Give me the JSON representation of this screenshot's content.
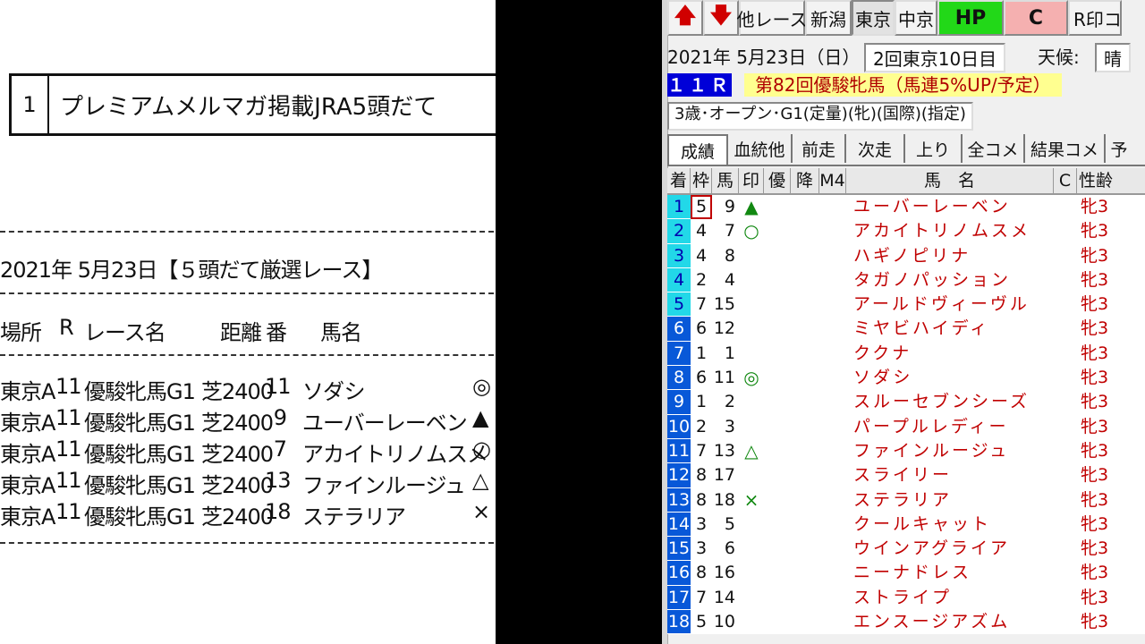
{
  "left": {
    "box_number": "1",
    "box_title": "プレミアムメルマガ掲載JRA5頭だて",
    "date_line": "2021年 5月23日【５頭だて厳選レース】",
    "headers": {
      "venue": "場所",
      "r": "R",
      "race": "レース名",
      "dist": "距離",
      "num": "番",
      "horse": "馬名"
    },
    "rows": [
      {
        "venue": "東京A",
        "r": "11",
        "race": "優駿牝馬G1",
        "dist": "芝2400",
        "num": "11",
        "horse": "ソダシ",
        "mark": "◎"
      },
      {
        "venue": "東京A",
        "r": "11",
        "race": "優駿牝馬G1",
        "dist": "芝2400",
        "num": "9",
        "horse": "ユーバーレーベン",
        "mark": "▲"
      },
      {
        "venue": "東京A",
        "r": "11",
        "race": "優駿牝馬G1",
        "dist": "芝2400",
        "num": "7",
        "horse": "アカイトリノムスメ",
        "mark": "○"
      },
      {
        "venue": "東京A",
        "r": "11",
        "race": "優駿牝馬G1",
        "dist": "芝2400",
        "num": "13",
        "horse": "ファインルージュ",
        "mark": "△"
      },
      {
        "venue": "東京A",
        "r": "11",
        "race": "優駿牝馬G1",
        "dist": "芝2400",
        "num": "18",
        "horse": "ステラリア",
        "mark": "×"
      }
    ]
  },
  "right": {
    "toolbar": {
      "up_icon": "up-arrow-icon",
      "down_icon": "down-arrow-icon",
      "up_glyph": "🡅",
      "down_glyph": "🡇",
      "other_race": "他レース",
      "niigata": "新潟",
      "tokyo": "東京",
      "chukyo": "中京",
      "hp": "HP",
      "c": "C",
      "r_print": "R印コ"
    },
    "info": {
      "date": "2021年 5月23日（日）",
      "meeting": "2回東京10日目",
      "weather_label": "天候:",
      "weather": "晴"
    },
    "race_no": "１１Ｒ",
    "race_name": "第82回優駿牝馬（馬連5%UP/予定）",
    "conditions": "3歳･オープン･G1(定量)(牝)(国際)(指定)",
    "tabs": [
      "成績",
      "血統他",
      "前走",
      "次走",
      "上り",
      "全コメ",
      "結果コメ",
      "予"
    ],
    "grid_headers": {
      "pos": "着",
      "waku": "枠",
      "uma": "馬",
      "mark": "印",
      "yu": "優",
      "ko": "降",
      "m4": "M4",
      "name": "馬　名",
      "c": "C",
      "sex": "性齢"
    },
    "rows": [
      {
        "pos": "1",
        "waku": "5",
        "uma": "9",
        "mark": "▲",
        "name": "ユーバーレーベン",
        "sex": "牝3"
      },
      {
        "pos": "2",
        "waku": "4",
        "uma": "7",
        "mark": "○",
        "name": "アカイトリノムスメ",
        "sex": "牝3"
      },
      {
        "pos": "3",
        "waku": "4",
        "uma": "8",
        "mark": "",
        "name": "ハギノピリナ",
        "sex": "牝3"
      },
      {
        "pos": "4",
        "waku": "2",
        "uma": "4",
        "mark": "",
        "name": "タガノパッション",
        "sex": "牝3"
      },
      {
        "pos": "5",
        "waku": "7",
        "uma": "15",
        "mark": "",
        "name": "アールドヴィーヴル",
        "sex": "牝3"
      },
      {
        "pos": "6",
        "waku": "6",
        "uma": "12",
        "mark": "",
        "name": "ミヤビハイディ",
        "sex": "牝3"
      },
      {
        "pos": "7",
        "waku": "1",
        "uma": "1",
        "mark": "",
        "name": "ククナ",
        "sex": "牝3"
      },
      {
        "pos": "8",
        "waku": "6",
        "uma": "11",
        "mark": "◎",
        "name": "ソダシ",
        "sex": "牝3"
      },
      {
        "pos": "9",
        "waku": "1",
        "uma": "2",
        "mark": "",
        "name": "スルーセブンシーズ",
        "sex": "牝3"
      },
      {
        "pos": "10",
        "waku": "2",
        "uma": "3",
        "mark": "",
        "name": "パープルレディー",
        "sex": "牝3"
      },
      {
        "pos": "11",
        "waku": "7",
        "uma": "13",
        "mark": "△",
        "name": "ファインルージュ",
        "sex": "牝3"
      },
      {
        "pos": "12",
        "waku": "8",
        "uma": "17",
        "mark": "",
        "name": "スライリー",
        "sex": "牝3"
      },
      {
        "pos": "13",
        "waku": "8",
        "uma": "18",
        "mark": "×",
        "name": "ステラリア",
        "sex": "牝3"
      },
      {
        "pos": "14",
        "waku": "3",
        "uma": "5",
        "mark": "",
        "name": "クールキャット",
        "sex": "牝3"
      },
      {
        "pos": "15",
        "waku": "3",
        "uma": "6",
        "mark": "",
        "name": "ウインアグライア",
        "sex": "牝3"
      },
      {
        "pos": "16",
        "waku": "8",
        "uma": "16",
        "mark": "",
        "name": "ニーナドレス",
        "sex": "牝3"
      },
      {
        "pos": "17",
        "waku": "7",
        "uma": "14",
        "mark": "",
        "name": "ストライプ",
        "sex": "牝3"
      },
      {
        "pos": "18",
        "waku": "5",
        "uma": "10",
        "mark": "",
        "name": "エンスージアズム",
        "sex": "牝3"
      }
    ]
  }
}
